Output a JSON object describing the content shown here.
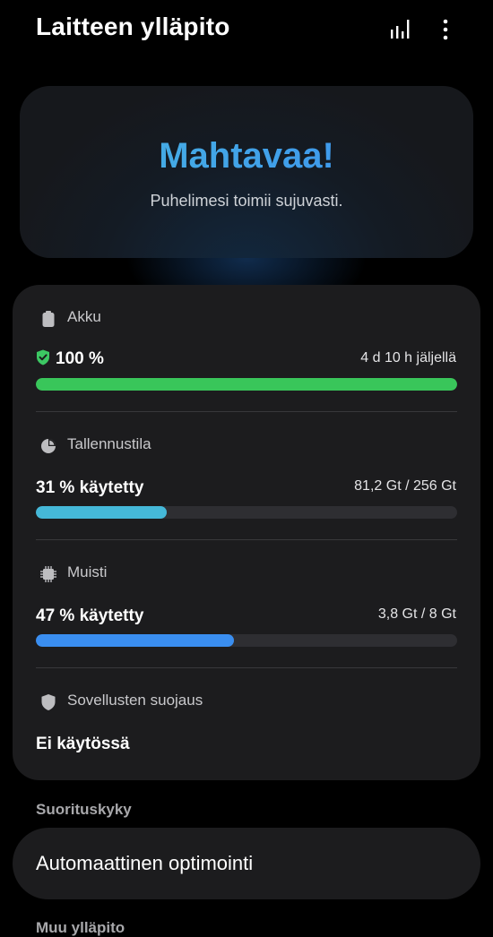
{
  "header": {
    "title": "Laitteen ylläpito",
    "icons": [
      "stats-icon",
      "more-options-icon"
    ]
  },
  "hero": {
    "title": "Mahtavaa!",
    "subtitle": "Puhelimesi toimii sujuvasti."
  },
  "battery": {
    "label": "Akku",
    "value": "100 %",
    "remaining": "4 d 10 h jäljellä",
    "level": 1.0,
    "color": "#39c65a"
  },
  "storage": {
    "label": "Tallennustila",
    "value": "31 % käytetty",
    "detail": "81,2 Gt / 256 Gt",
    "level": 0.31,
    "color": "#45b8d8"
  },
  "memory": {
    "label": "Muisti",
    "value": "47 % käytetty",
    "detail": "3,8 Gt / 8 Gt",
    "level": 0.47,
    "color": "#3a8ef0"
  },
  "app_protection": {
    "label": "Sovellusten suojaus",
    "value": "Ei käytössä"
  },
  "performance": {
    "section_label": "Suorituskyky",
    "auto_optimization": "Automaattinen optimointi"
  },
  "other": {
    "section_label": "Muu ylläpito"
  }
}
